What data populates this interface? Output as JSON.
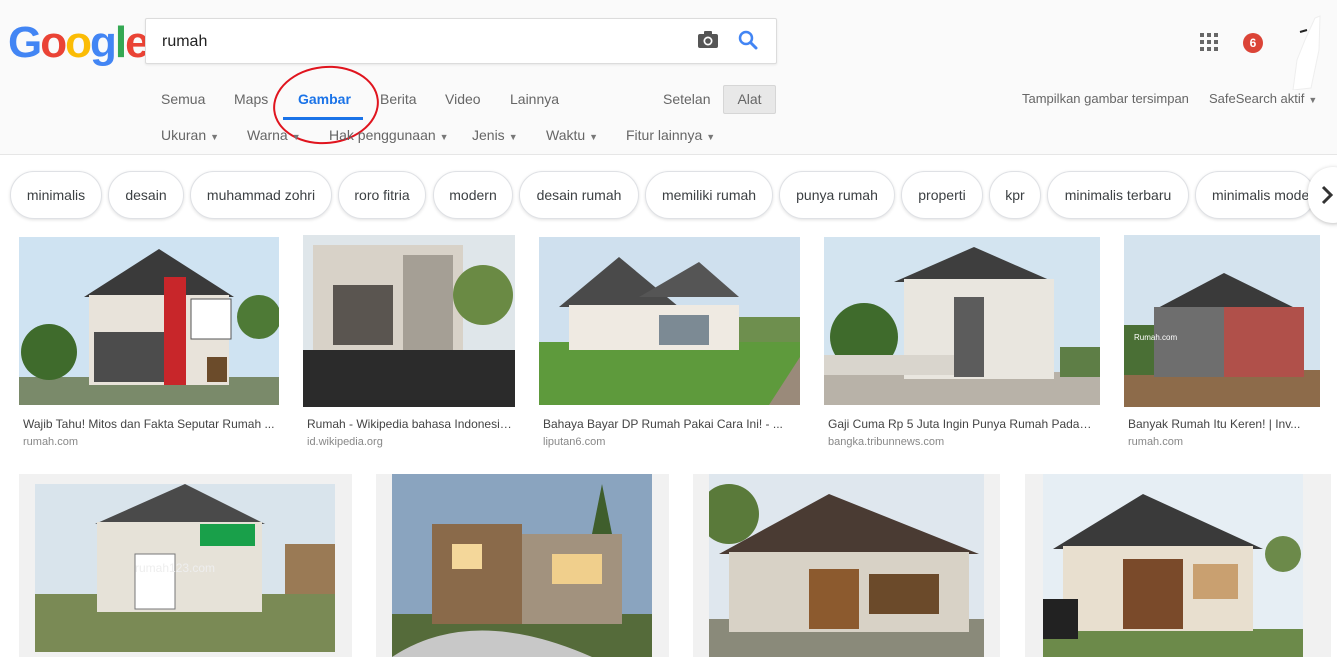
{
  "search": {
    "query": "rumah"
  },
  "nav": {
    "tabs": [
      "Semua",
      "Maps",
      "Gambar",
      "Berita",
      "Video",
      "Lainnya"
    ],
    "active_tab": "Gambar",
    "settings_label": "Setelan",
    "tools_label": "Alat",
    "saved_images_label": "Tampilkan gambar tersimpan",
    "safesearch_label": "SafeSearch aktif"
  },
  "filters": [
    "Ukuran",
    "Warna",
    "Hak penggunaan",
    "Jenis",
    "Waktu",
    "Fitur lainnya"
  ],
  "notifications": {
    "count": "6"
  },
  "chips": [
    "minimalis",
    "desain",
    "muhammad zohri",
    "roro fitria",
    "modern",
    "desain rumah",
    "memiliki rumah",
    "punya rumah",
    "properti",
    "kpr",
    "minimalis terbaru",
    "minimalis mode"
  ],
  "results_row1": [
    {
      "caption": "Wajib Tahu! Mitos dan Fakta Seputar Rumah ...",
      "source": "rumah.com"
    },
    {
      "caption": "Rumah - Wikipedia bahasa Indonesia ...",
      "source": "id.wikipedia.org"
    },
    {
      "caption": "Bahaya Bayar DP Rumah Pakai Cara Ini! - ...",
      "source": "liputan6.com"
    },
    {
      "caption": "Gaji Cuma Rp 5 Juta Ingin Punya Rumah Padahal ...",
      "source": "bangka.tribunnews.com"
    },
    {
      "caption": "Banyak Rumah Itu Keren! | Inv...",
      "source": "rumah.com"
    }
  ],
  "watermarks": {
    "rumah_com": "Rumah.com",
    "rumah123": "rumah123.com"
  },
  "colors": {
    "google_blue": "#4285F4",
    "google_red": "#EA4335",
    "google_yellow": "#FBBC05",
    "google_green": "#34A853",
    "active_tab": "#1a73e8",
    "annotation_circle": "#e0141e"
  }
}
